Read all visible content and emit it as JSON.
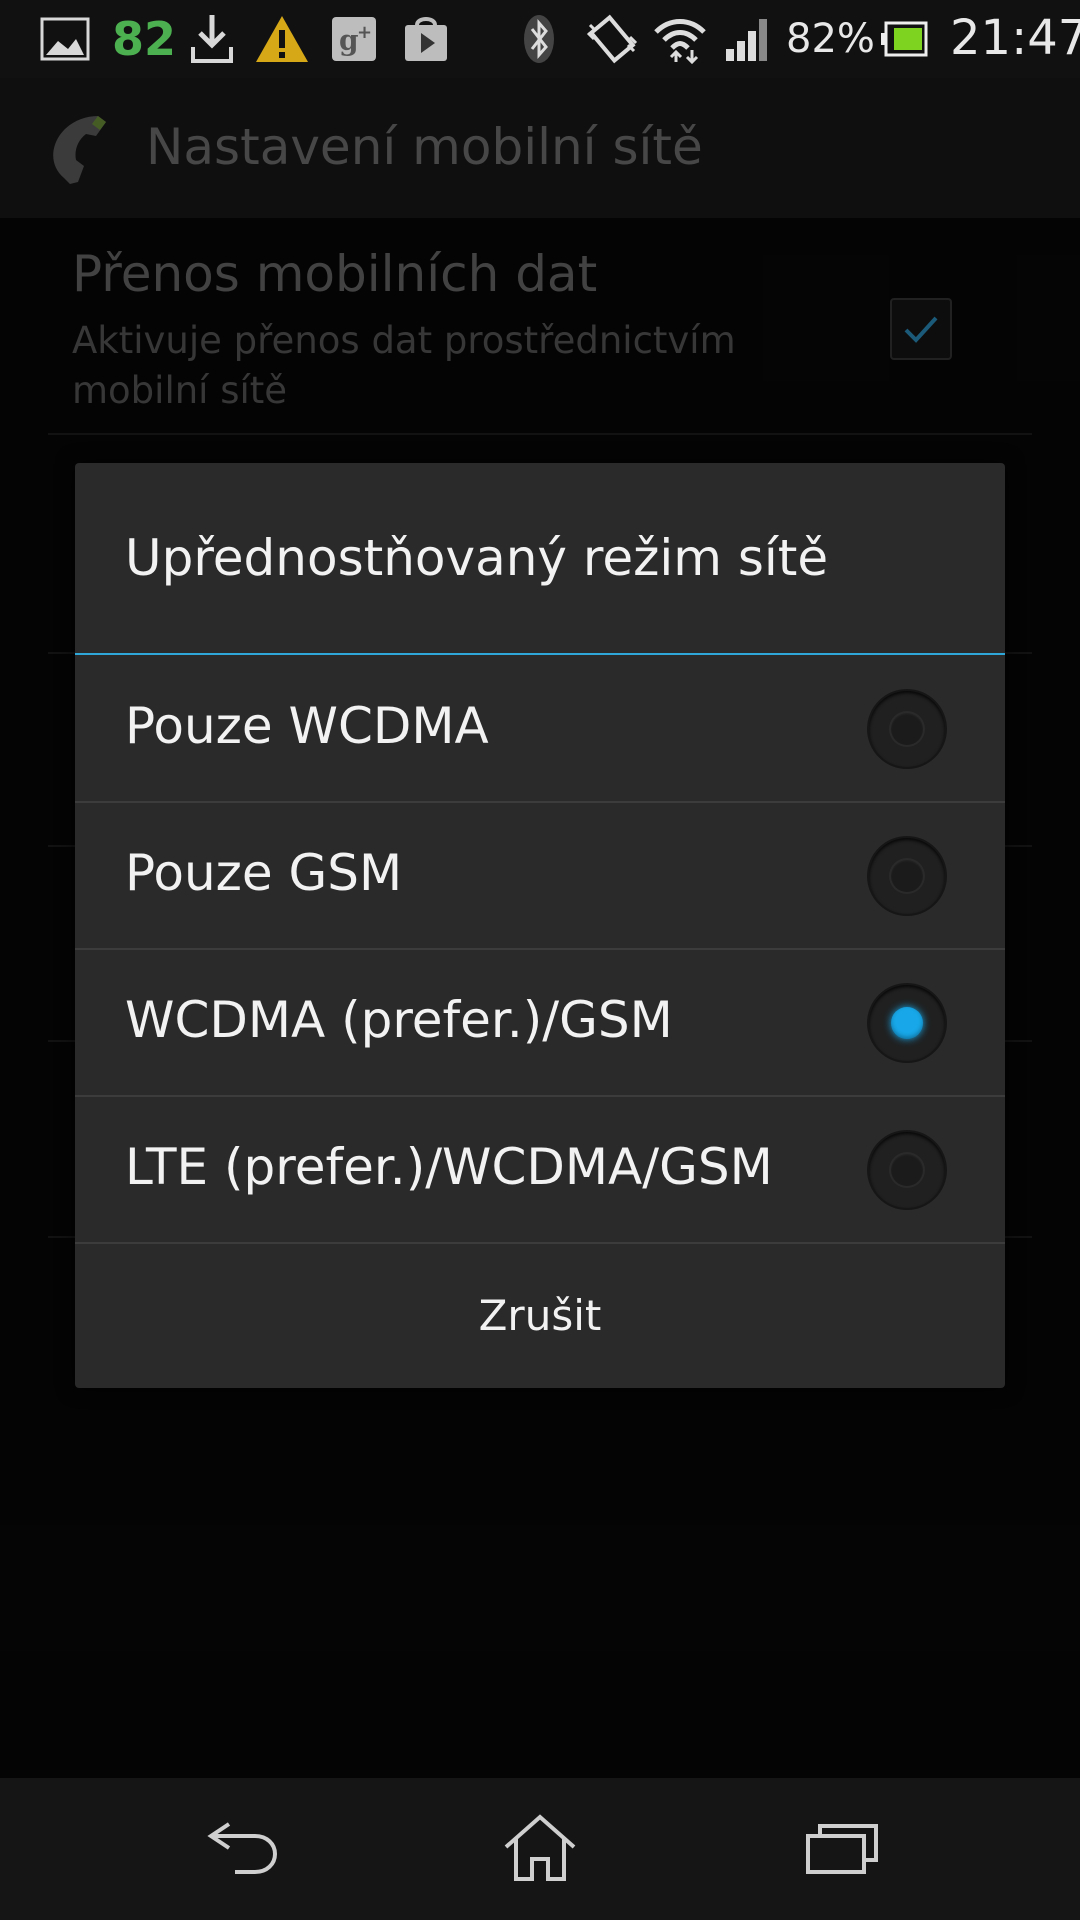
{
  "status_bar": {
    "notification_count": "82",
    "battery_percent": "82%",
    "time": "21:47",
    "icons": [
      "gallery-icon",
      "download-icon",
      "warning-icon",
      "google-plus-icon",
      "play-store-icon",
      "bluetooth-icon",
      "vibrate-icon",
      "wifi-icon",
      "signal-icon",
      "battery-icon"
    ]
  },
  "action_bar": {
    "title": "Nastavení mobilní sítě",
    "icon": "phone-icon"
  },
  "background": {
    "item_title": "Přenos mobilních dat",
    "item_subtitle": "Aktivuje přenos dat prostřednictvím mobilní sítě",
    "item_checked": true
  },
  "dialog": {
    "title": "Upřednostňovaný režim sítě",
    "options": [
      {
        "label": "Pouze WCDMA",
        "selected": false
      },
      {
        "label": "Pouze GSM",
        "selected": false
      },
      {
        "label": "WCDMA (prefer.)/GSM",
        "selected": true
      },
      {
        "label": "LTE (prefer.)/WCDMA/GSM",
        "selected": false
      }
    ],
    "cancel_label": "Zrušit"
  },
  "nav_bar": {
    "buttons": [
      "back-icon",
      "home-icon",
      "recent-apps-icon"
    ]
  },
  "colors": {
    "accent": "#18a7e8",
    "dialog_bg": "#2a2a2a",
    "warning": "#d6a817",
    "notification_green": "#4caf50",
    "battery_green": "#7ed321"
  }
}
